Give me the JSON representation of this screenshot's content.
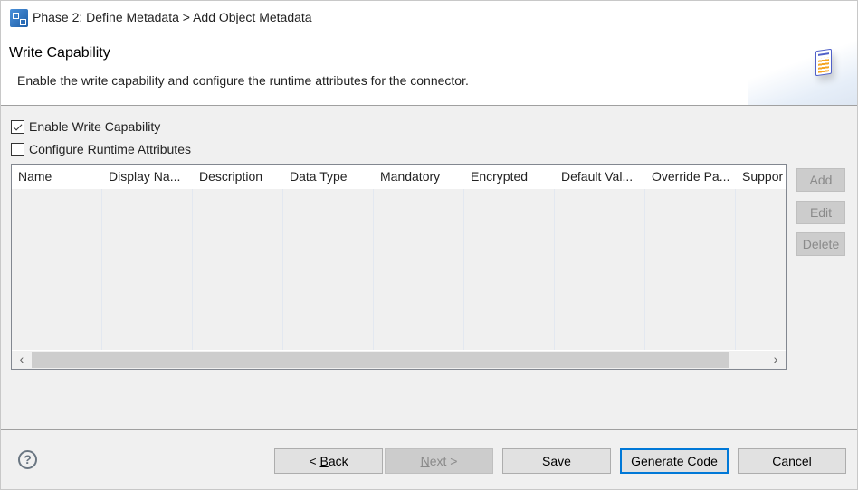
{
  "window": {
    "title": "Phase 2: Define Metadata > Add Object Metadata",
    "icon": "wizard-app-icon"
  },
  "banner": {
    "title": "Write Capability",
    "description": "Enable the write capability and configure the runtime attributes for the connector.",
    "icon": "table-spreadsheet-icon"
  },
  "options": {
    "enable_write": {
      "label": "Enable Write Capability",
      "checked": true
    },
    "configure_runtime": {
      "label": "Configure Runtime Attributes",
      "checked": false
    }
  },
  "table": {
    "columns": [
      "Name",
      "Display Na...",
      "Description",
      "Data Type",
      "Mandatory",
      "Encrypted",
      "Default Val...",
      "Override Pa...",
      "Suppor"
    ],
    "rows": [],
    "scroll_left": "‹",
    "scroll_right": "›"
  },
  "side_buttons": {
    "add": "Add",
    "edit": "Edit",
    "delete": "Delete"
  },
  "footer": {
    "help": "?",
    "back_prefix": "< ",
    "back_mnemonic": "B",
    "back_rest": "ack",
    "next_mnemonic": "N",
    "next_rest": "ext >",
    "save": "Save",
    "generate": "Generate Code",
    "cancel": "Cancel"
  }
}
